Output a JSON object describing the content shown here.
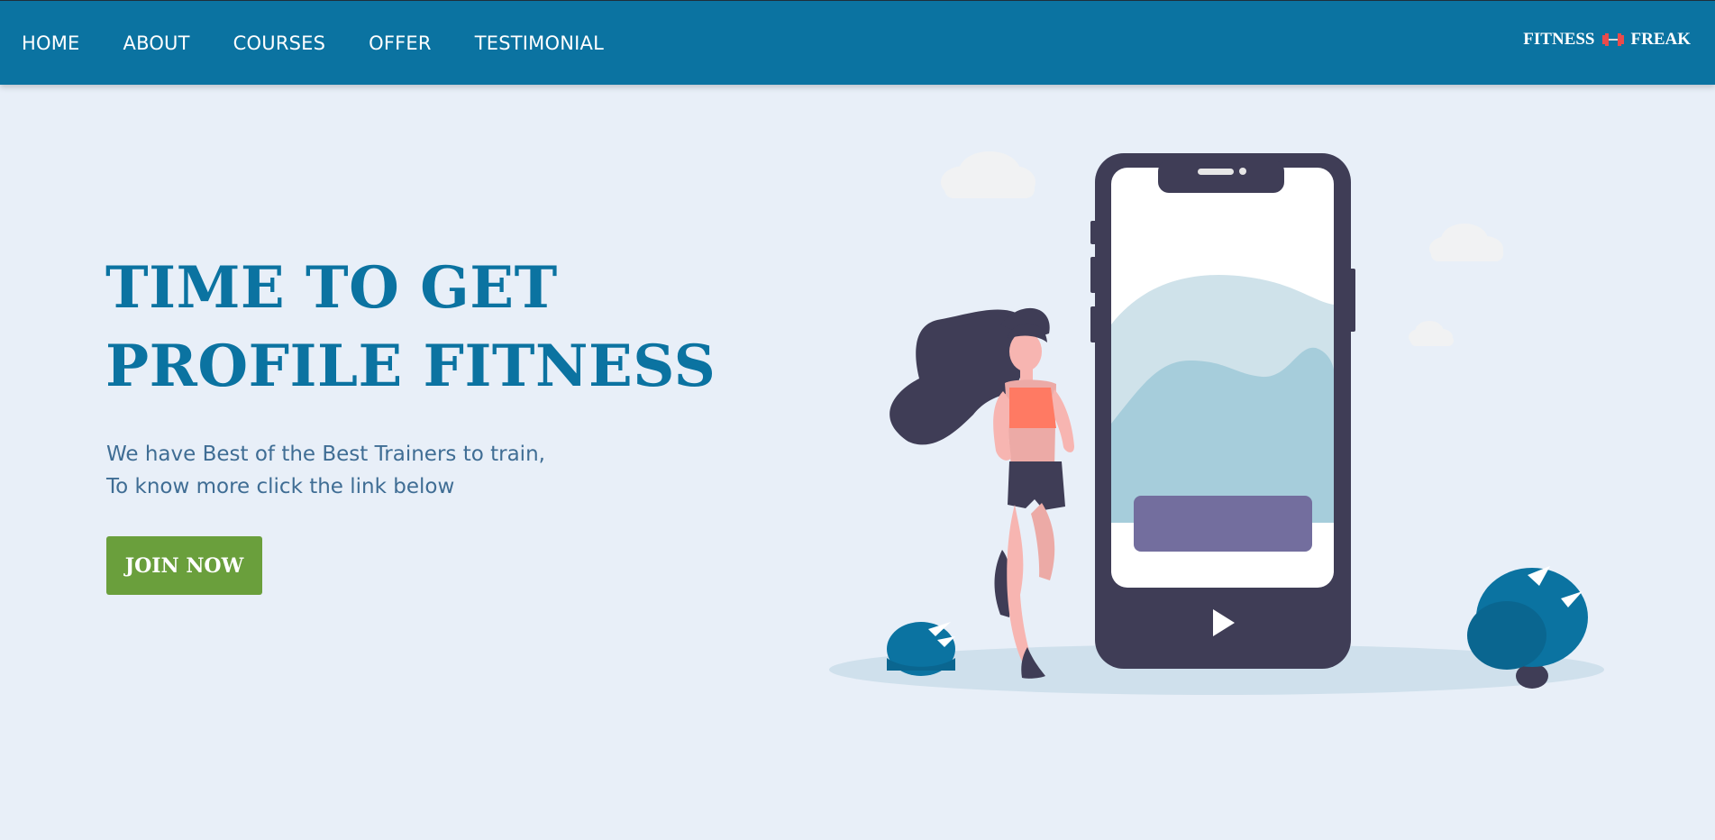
{
  "nav": {
    "items": [
      {
        "label": "HOME"
      },
      {
        "label": "ABOUT"
      },
      {
        "label": "COURSES"
      },
      {
        "label": "OFFER"
      },
      {
        "label": "TESTIMONIAL"
      }
    ],
    "brand": {
      "left_text": "FITNESS",
      "icon": "dumbbell-icon",
      "right_text": "FREAK"
    }
  },
  "hero": {
    "title_line1": "TIME TO GET",
    "title_line2": "PROFILE FITNESS",
    "text_line1": "We have Best of the Best Trainers to train,",
    "text_line2": "To know more click the link below",
    "cta_label": "JOIN NOW"
  },
  "colors": {
    "nav_bg": "#0b73a1",
    "page_bg": "#e8eff8",
    "title": "#0b73a1",
    "body_text": "#3f6d94",
    "cta_bg": "#6a9f3c",
    "phone_body": "#3f3d56",
    "phone_button": "#736e9e",
    "bush": "#0b73a1"
  },
  "illustration": {
    "icons": [
      "phone-illustration",
      "runner-illustration",
      "cloud-icon",
      "bush-icon",
      "play-icon"
    ]
  }
}
